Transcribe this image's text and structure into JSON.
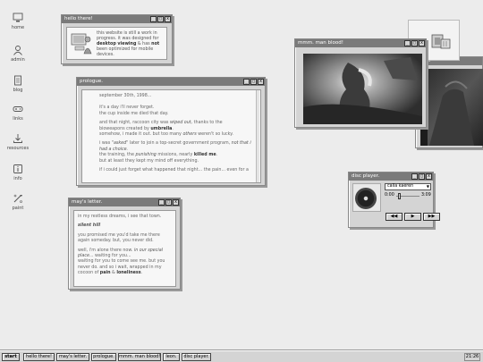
{
  "desktop_icons": [
    {
      "label": "home",
      "icon": "computer-icon"
    },
    {
      "label": "admin",
      "icon": "person-icon"
    },
    {
      "label": "blog",
      "icon": "notepad-icon"
    },
    {
      "label": "links",
      "icon": "gamepad-icon"
    },
    {
      "label": "resources",
      "icon": "download-icon"
    },
    {
      "label": "info",
      "icon": "info-icon"
    },
    {
      "label": "paint",
      "icon": "paint-icon"
    }
  ],
  "window_controls": {
    "minimize": "_",
    "maximize": "□",
    "close": "x"
  },
  "hello": {
    "title": "hello there!",
    "t1": "this website is still a work in progress. it was designed for",
    "b1": "desktop viewing",
    "t2": " & has ",
    "b2": "not",
    "t3": " been optimized for mobile devices."
  },
  "prologue": {
    "title": "prologue.",
    "date": "september 30th, 1998...",
    "p2a": "it's a day i'll never forget.",
    "p2b": "the cup inside me died that day.",
    "p3a": "and that night, raccoon city was ",
    "p3i": "wiped out,",
    "p3b": " thanks to the",
    "p3c": "bioweapons created by ",
    "p3bb": "umbrella",
    "p3d": ".",
    "p3e": "somehow, i made it out. but too many ",
    "p3ei": "others",
    "p3f": " weren't so lucky.",
    "p4a": "i was \"",
    "p4ai": "asked",
    "p4b": "\" later to join a top-secret government program, ",
    "p4bi": "not that i had a choice.",
    "p4c": "the training, the ",
    "p4ci": "punishing",
    "p4d": " missions, nearly ",
    "p4db": "killed me",
    "p4e": ".",
    "p4f": "but at least they kept my mind off everything.",
    "p5": "if i could just forget what happened that night... the pain... even for a"
  },
  "letter": {
    "title": "may's letter.",
    "l1": "in my restless dreams, i see that town.",
    "l2": "silent hill",
    "l3a": "you promised me you'd take me there",
    "l3b": "again someday. but, you never did.",
    "l4a": "well, i'm alone there now. ",
    "l4ai": "in our special place",
    "l4b": "... waiting for you...",
    "l4c": "waiting for you to come see me. but you",
    "l4d": "never do. and so i wait, wrapped in my",
    "l4e": "cocoon of ",
    "l4eb1": "pain",
    "l4f": " & ",
    "l4eb2": "loneliness",
    "l4g": "."
  },
  "blood": {
    "title": "mmm. man blood!"
  },
  "leon": {
    "title": "leon."
  },
  "disc": {
    "title": "disc player.",
    "track": "calla kaeren",
    "time_start": "0:00",
    "time_end": "3:09",
    "progress": 0.1,
    "btn_prev": "◀◀",
    "btn_play": "▶",
    "btn_next": "▶▶"
  },
  "taskbar": {
    "start": "start",
    "items": [
      "hello there!",
      "may's letter.",
      "prologue.",
      "mmm. man blood!",
      "leon.",
      "disc player."
    ],
    "clock": "21:26"
  }
}
